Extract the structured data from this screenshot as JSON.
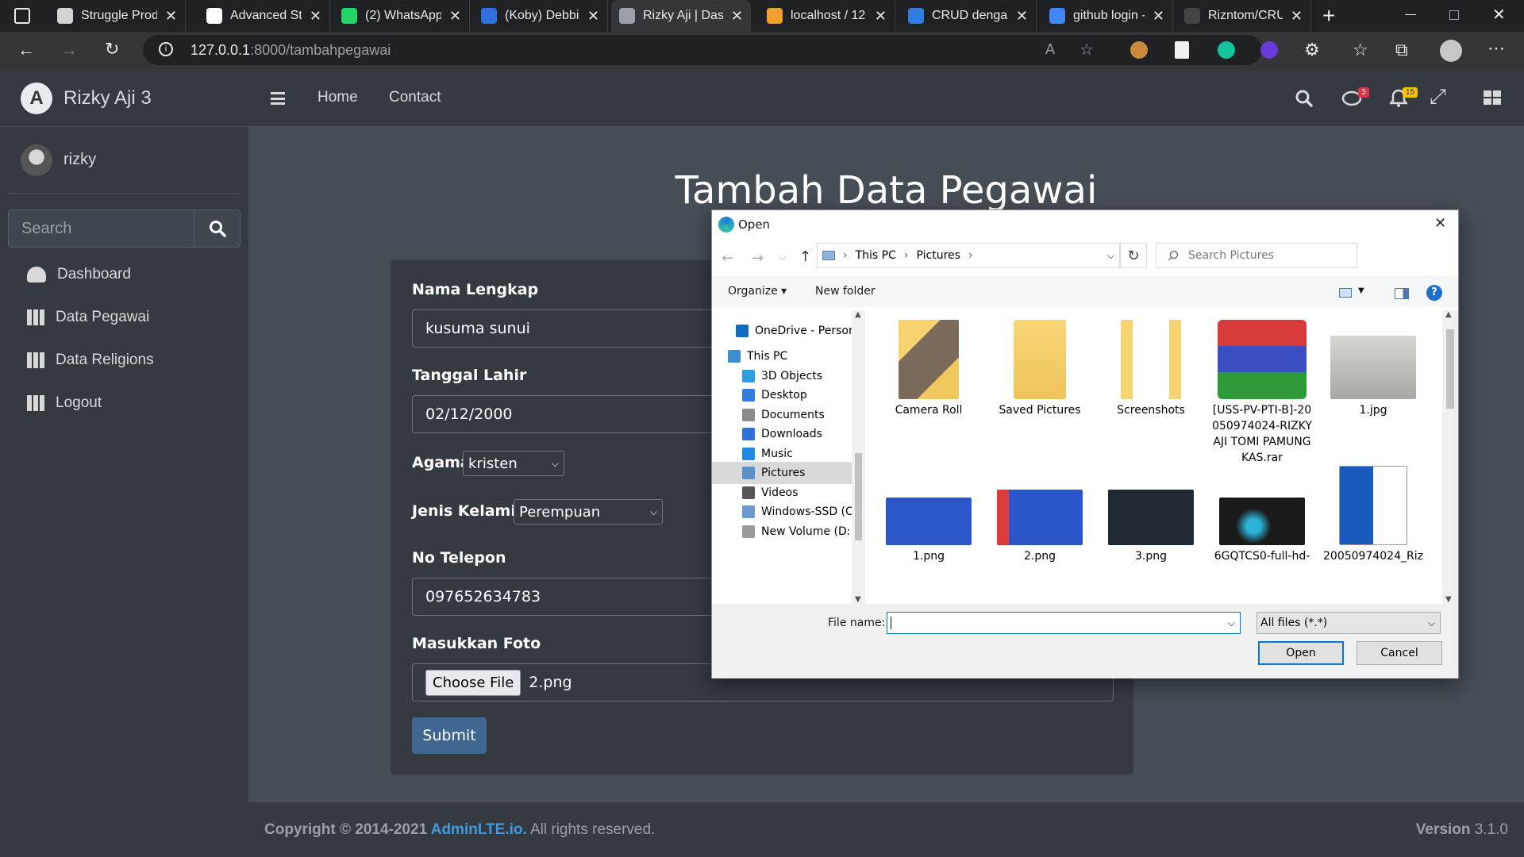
{
  "browser": {
    "tabs": [
      {
        "title": "Struggle Prod",
        "color": "#d3d3d3"
      },
      {
        "title": "Advanced Stru",
        "color": "#ffffff"
      },
      {
        "title": "(2) WhatsApp",
        "color": "#25d366"
      },
      {
        "title": "(Koby) Debbie",
        "color": "#2f6fde"
      },
      {
        "title": "Rizky Aji | Das",
        "color": "#9aa0a6"
      },
      {
        "title": "localhost / 12",
        "color": "#f0a030"
      },
      {
        "title": "CRUD dengan",
        "color": "#2f7de1"
      },
      {
        "title": "github login -",
        "color": "#4285f4"
      },
      {
        "title": "Rizntom/CRU",
        "color": "#444444"
      }
    ],
    "url_host": "127.0.0.1",
    "url_path": ":8000/tambahpegawai"
  },
  "sidebar": {
    "brand": "Rizky Aji 3",
    "user": "rizky",
    "search_placeholder": "Search",
    "items": [
      {
        "label": "Dashboard",
        "icon": "dashboard-icon"
      },
      {
        "label": "Data Pegawai",
        "icon": "grid-icon"
      },
      {
        "label": "Data Religions",
        "icon": "grid-icon"
      },
      {
        "label": "Logout",
        "icon": "grid-icon"
      }
    ]
  },
  "navbar": {
    "links": [
      "Home",
      "Contact"
    ],
    "messages_badge": "3",
    "notifications_badge": "15"
  },
  "page": {
    "title": "Tambah Data Pegawai",
    "form": {
      "nama_label": "Nama Lengkap",
      "nama_value": "kusuma sunui",
      "tanggal_label": "Tanggal Lahir",
      "tanggal_value": "02/12/2000",
      "agama_label": "Agama",
      "agama_value": "kristen",
      "jk_label": "Jenis Kelamin",
      "jk_value": "Perempuan",
      "telp_label": "No Telepon",
      "telp_value": "097652634783",
      "foto_label": "Masukkan Foto",
      "choose_file": "Choose File",
      "file_name": "2.png",
      "submit": "Submit"
    }
  },
  "footer": {
    "copyright": "Copyright © 2014-2021 ",
    "link": "AdminLTE.io.",
    "rights": " All rights reserved.",
    "version_label": "Version",
    "version": "3.1.0"
  },
  "dialog": {
    "title": "Open",
    "breadcrumb": [
      "This PC",
      "Pictures"
    ],
    "search_placeholder": "Search Pictures",
    "organize": "Organize",
    "new_folder": "New folder",
    "tree": [
      {
        "label": "OneDrive - Person",
        "icon_color": "#0f6cbd"
      },
      {
        "label": "This PC",
        "icon_color": "#3b8ed0"
      },
      {
        "label": "3D Objects",
        "icon_color": "#2aa0e0"
      },
      {
        "label": "Desktop",
        "icon_color": "#2f7de1"
      },
      {
        "label": "Documents",
        "icon_color": "#8a8a8a"
      },
      {
        "label": "Downloads",
        "icon_color": "#2f6fde"
      },
      {
        "label": "Music",
        "icon_color": "#1e88e5"
      },
      {
        "label": "Pictures",
        "icon_color": "#5b8fc7"
      },
      {
        "label": "Videos",
        "icon_color": "#555555"
      },
      {
        "label": "Windows-SSD (C",
        "icon_color": "#6a9ad0"
      },
      {
        "label": "New Volume (D:",
        "icon_color": "#9a9a9a"
      }
    ],
    "files": [
      {
        "label": "Camera Roll",
        "kind": "folder-photo"
      },
      {
        "label": "Saved Pictures",
        "kind": "folder"
      },
      {
        "label": "Screenshots",
        "kind": "folder-docs"
      },
      {
        "label": "[USS-PV-PTI-B]-20050974024-RIZKY AJI TOMI PAMUNGKAS.rar",
        "kind": "rar"
      },
      {
        "label": "1.jpg",
        "kind": "paper"
      },
      {
        "label": "1.png",
        "kind": "blue-diagram"
      },
      {
        "label": "2.png",
        "kind": "blue-grid"
      },
      {
        "label": "3.png",
        "kind": "terminal"
      },
      {
        "label": "6GQTCS0-full-hd-",
        "kind": "dark-photo"
      },
      {
        "label": "20050974024_Riz",
        "kind": "word"
      }
    ],
    "file_name_label": "File name:",
    "file_name_value": "",
    "filter": "All files (*.*)",
    "open_button": "Open",
    "cancel_button": "Cancel"
  }
}
